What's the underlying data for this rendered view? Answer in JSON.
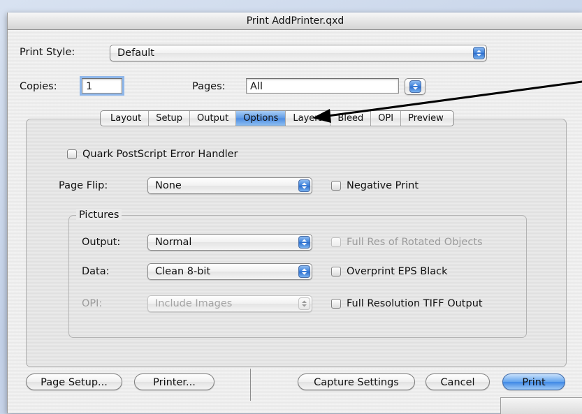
{
  "window": {
    "title": "Print AddPrinter.qxd"
  },
  "print_style": {
    "label": "Print Style:",
    "value": "Default"
  },
  "copies": {
    "label": "Copies:",
    "value": "1"
  },
  "pages": {
    "label": "Pages:",
    "value": "All"
  },
  "tabs": [
    {
      "label": "Layout",
      "selected": false
    },
    {
      "label": "Setup",
      "selected": false
    },
    {
      "label": "Output",
      "selected": false
    },
    {
      "label": "Options",
      "selected": true
    },
    {
      "label": "Layers",
      "selected": false
    },
    {
      "label": "Bleed",
      "selected": false
    },
    {
      "label": "OPI",
      "selected": false
    },
    {
      "label": "Preview",
      "selected": false
    }
  ],
  "options": {
    "error_handler": {
      "label": "Quark PostScript Error Handler",
      "checked": false
    },
    "page_flip": {
      "label": "Page Flip:",
      "value": "None"
    },
    "negative_print": {
      "label": "Negative Print",
      "checked": false
    },
    "pictures": {
      "title": "Pictures",
      "output": {
        "label": "Output:",
        "value": "Normal"
      },
      "data": {
        "label": "Data:",
        "value": "Clean 8-bit"
      },
      "opi": {
        "label": "OPI:",
        "value": "Include Images",
        "enabled": false
      },
      "full_res_rotated": {
        "label": "Full Res of Rotated Objects",
        "checked": false,
        "enabled": false
      },
      "overprint_eps": {
        "label": "Overprint EPS Black",
        "checked": false
      },
      "full_res_tiff": {
        "label": "Full Resolution TIFF Output",
        "checked": false
      }
    }
  },
  "buttons": {
    "page_setup": "Page Setup...",
    "printer": "Printer...",
    "capture_settings": "Capture Settings",
    "cancel": "Cancel",
    "print": "Print"
  },
  "colors": {
    "accent": "#4d8be0",
    "background": "#c9d6ea"
  }
}
